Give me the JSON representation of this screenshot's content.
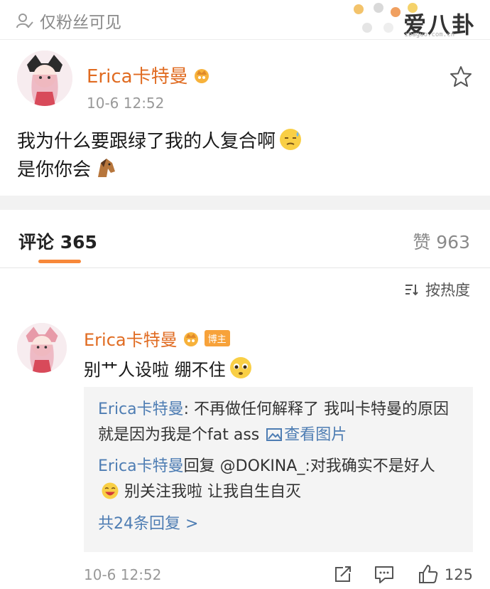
{
  "topbar": {
    "visibility_label": "仅粉丝可见",
    "watermark_text": "爱八卦",
    "watermark_url": "ibaguo.com.cn"
  },
  "post": {
    "author": "Erica卡特曼",
    "time": "10-6 12:52",
    "line1": "我为什么要跟绿了我的人复合啊",
    "line2": "是你你会"
  },
  "tabs": {
    "comments_label": "评论 365",
    "likes_label": "赞 963"
  },
  "sort": {
    "label": "按热度"
  },
  "comment": {
    "author": "Erica卡特曼",
    "badge": "博主",
    "text": "别艹人设啦 绷不住",
    "replies": [
      {
        "name": "Erica卡特曼",
        "text": ": 不再做任何解释了 我叫卡特曼的原因就是因为我是个fat ass",
        "link": "查看图片"
      },
      {
        "name": "Erica卡特曼",
        "text": "回复 @DOKINA_:对我确实不是好人",
        "text2": "别关注我啦 让我自生自灭"
      }
    ],
    "more_replies": "共24条回复 >",
    "time": "10-6 12:52",
    "like_count": "125"
  },
  "colors": {
    "accent_orange": "#e06b21",
    "link_blue": "#4e7db3",
    "tab_underline": "#f7883a"
  }
}
